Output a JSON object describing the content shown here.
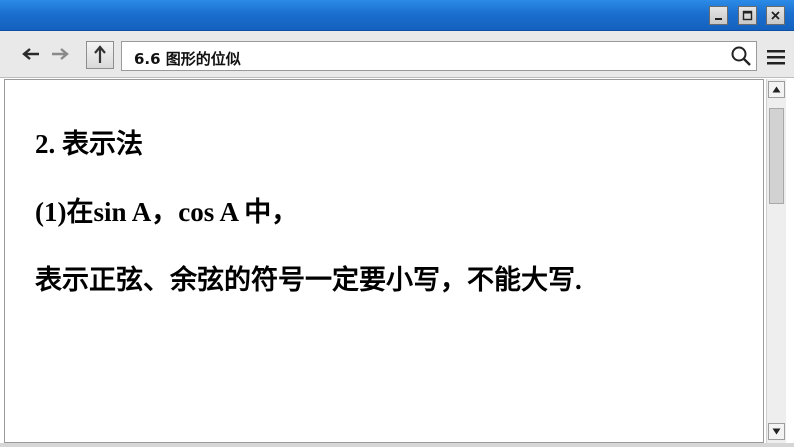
{
  "window": {
    "title_bar_color": "#1b6fcf",
    "controls": [
      "minimize-icon",
      "maximize-icon",
      "close-icon"
    ]
  },
  "toolbar": {
    "back_icon": "arrow-left-icon",
    "forward_icon": "arrow-right-icon",
    "up_icon": "arrow-up-icon",
    "address": "6.6 图形的位似",
    "search_icon": "search-icon",
    "menu_icon": "hamburger-menu-icon"
  },
  "content": {
    "lines": [
      "2. 表示法",
      "(1)在sin A，cos A 中，",
      "表示正弦、余弦的符号一定要小写，不能大写."
    ]
  },
  "scrollbar": {
    "position": 0.0
  }
}
